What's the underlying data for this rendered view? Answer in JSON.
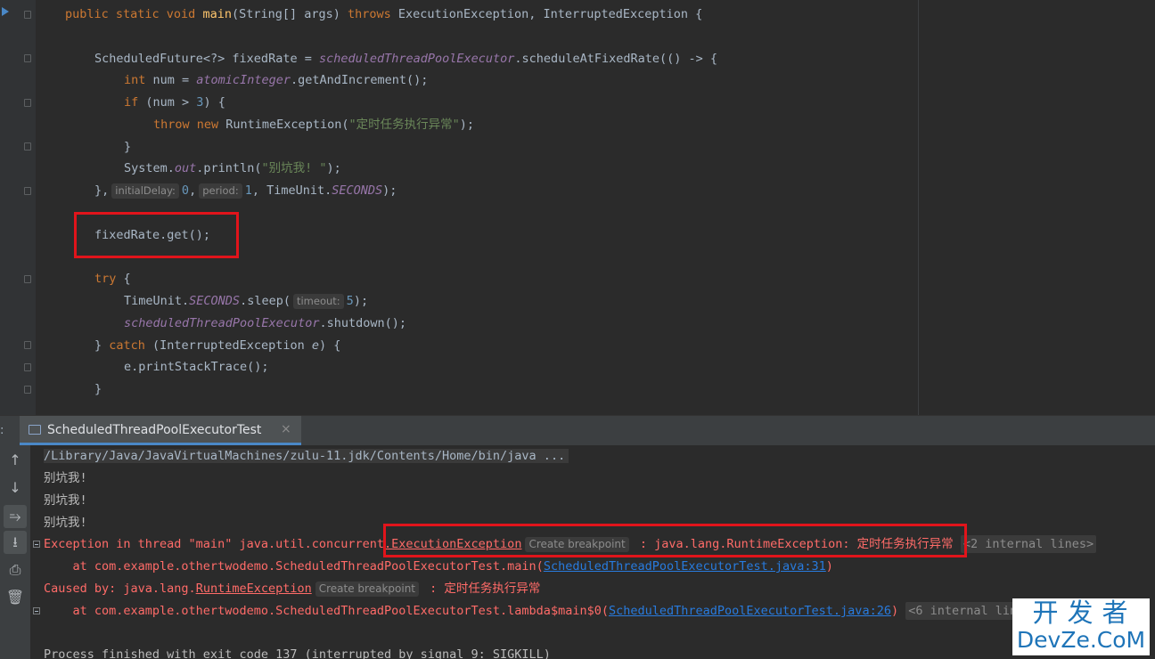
{
  "editor": {
    "lines": {
      "l1_a": "public static void ",
      "l1_fn": "main",
      "l1_b": "(String[] args) ",
      "l1_kw": "throws",
      "l1_c": " ExecutionException, InterruptedException {",
      "l3_a": "ScheduledFuture<?> fixedRate = ",
      "l3_fld": "scheduledThreadPoolExecutor",
      "l3_b": ".scheduleAtFixedRate(() -> {",
      "l4_kw": "int",
      "l4_a": " num = ",
      "l4_fld": "atomicInteger",
      "l4_b": ".getAndIncrement();",
      "l5_kw": "if",
      "l5_a": " (num > ",
      "l5_num": "3",
      "l5_b": ") {",
      "l6_kw1": "throw",
      "l6_kw2": " new",
      "l6_a": " RuntimeException(",
      "l6_str": "\"定时任务执行异常\"",
      "l6_b": ");",
      "l7": "}",
      "l8_a": "System.",
      "l8_fld": "out",
      "l8_b": ".println(",
      "l8_str": "\"别坑我! \"",
      "l8_c": ");",
      "l9_a": "},",
      "l9_hint1": "initialDelay:",
      "l9_num1": "0",
      "l9_b": ",",
      "l9_hint2": "period:",
      "l9_num2": "1",
      "l9_c": ", TimeUnit.",
      "l9_fld": "SECONDS",
      "l9_d": ");",
      "l11": "fixedRate.get();",
      "l13_kw": "try",
      "l13_a": " {",
      "l14_a": "TimeUnit.",
      "l14_fld": "SECONDS",
      "l14_b": ".sleep(",
      "l14_hint": "timeout:",
      "l14_num": "5",
      "l14_c": ");",
      "l15_fld": "scheduledThreadPoolExecutor",
      "l15_a": ".shutdown();",
      "l16_a": "} ",
      "l16_kw": "catch",
      "l16_b": " (InterruptedException ",
      "l16_it": "e",
      "l16_c": ") {",
      "l17": "e.printStackTrace();",
      "l18": "}"
    }
  },
  "run_panel": {
    "prefix": ":",
    "tab_label": "ScheduledThreadPoolExecutorTest",
    "tab_close": "×"
  },
  "toolbar": {
    "up": "↑",
    "down": "↓",
    "wrap": "⥱",
    "scroll_end": "⭳",
    "print": "⎙",
    "trash": "🗑"
  },
  "console": {
    "path": "/Library/Java/JavaVirtualMachines/zulu-11.jdk/Contents/Home/bin/java ...",
    "out1": "别坑我!",
    "out2": "别坑我!",
    "out3": "别坑我!",
    "exc_a": "Exception in thread \"main\" java.util.concurrent",
    "exc_link": ".ExecutionException",
    "exc_bp": "Create breakpoint",
    "exc_b": " : java.lang.RuntimeException: 定时任务执行异常",
    "exc_internal": "<2 internal lines>",
    "at1_a": "    at com.example.othertwodemo.ScheduledThreadPoolExecutorTest.main(",
    "at1_link": "ScheduledThreadPoolExecutorTest.java:31",
    "at1_b": ")",
    "caused_a": "Caused by: java.lang.",
    "caused_link": "RuntimeException",
    "caused_bp": "Create breakpoint",
    "caused_b": " : 定时任务执行异常",
    "at2_a": "    at com.example.othertwodemo.ScheduledThreadPoolExecutorTest.lambda$main$0(",
    "at2_link": "ScheduledThreadPoolExecutorTest.java:26",
    "at2_b": ")",
    "at2_internal": "<6 internal lines>",
    "finished": "Process finished with exit code 137 (interrupted by signal 9: SIGKILL)"
  },
  "watermark": {
    "top": "开发者",
    "bottom": "DevZe.CoM"
  },
  "colors": {
    "keyword": "#cc7832",
    "function": "#ffc66d",
    "number": "#6897bb",
    "string": "#6a8759",
    "field": "#9876aa",
    "error": "#ff6b68",
    "link": "#287bde",
    "highlight_box": "#e1141b"
  }
}
